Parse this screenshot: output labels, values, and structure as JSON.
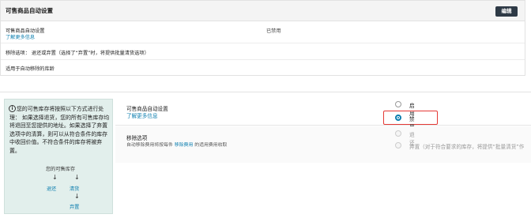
{
  "top": {
    "title": "可售商品自动设置",
    "edit_label": "编辑",
    "row1_label": "可售商品自动设置",
    "row1_link": "了解更多信息",
    "row1_status": "已禁用",
    "row2_text": "移除选项： 退还或弃置（选择了“弃置”时，将提供批量清货选项）",
    "row3_text": "适用于自动移除的库龄"
  },
  "info": {
    "text": "您的可售库存将按照以下方式进行处理： 如果选择退货，您的所有可售库存均将退回至您提供的地址。如果选择了弃置选项中的清算，则可以从符合条件的库存中收回价值。不符合条件的库存将被弃置。",
    "flow_top": "您的可售库存",
    "arrow": "↓",
    "flow_return": "退还",
    "flow_liquidate": "清货",
    "flow_dispose": "弃置"
  },
  "settings": {
    "title": "可售商品自动设置",
    "link": "了解更多信息",
    "enable_label": "启用",
    "disable_label": "禁用",
    "selected": "禁用"
  },
  "removal": {
    "title": "移除选项",
    "sub_prefix": "自动移除费用将按每件",
    "sub_link": "移除费用",
    "sub_suffix": "的适用费用收取",
    "opt_return": "退还",
    "opt_dispose": "弃置（对于符合要求的库存，将提供“批量清货”作"
  }
}
